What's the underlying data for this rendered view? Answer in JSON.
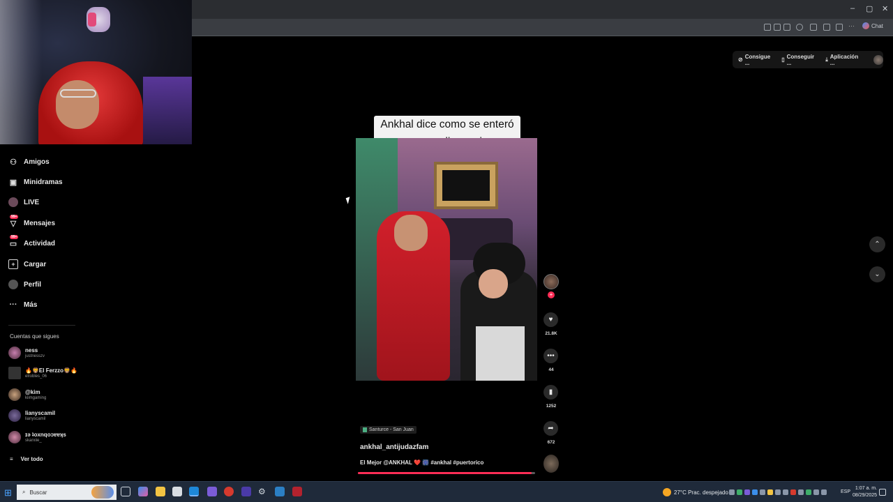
{
  "browser": {
    "window_controls": [
      "–",
      "▢",
      "✕"
    ],
    "chat_label": "Chat"
  },
  "sidebar": {
    "items": [
      {
        "label": "Amigos",
        "icon": "friends-icon"
      },
      {
        "label": "Minidramas",
        "icon": "minidramas-icon"
      },
      {
        "label": "LIVE",
        "icon": "live-icon"
      },
      {
        "label": "Mensajes",
        "icon": "messages-icon",
        "badge": "99+"
      },
      {
        "label": "Actividad",
        "icon": "activity-icon",
        "badge": "99+"
      },
      {
        "label": "Cargar",
        "icon": "upload-icon"
      },
      {
        "label": "Perfil",
        "icon": "profile-icon"
      },
      {
        "label": "Más",
        "icon": "more-icon"
      }
    ],
    "following_title": "Cuentas que sigues",
    "following": [
      {
        "name": "ness",
        "user": "justnesszv"
      },
      {
        "name": "🔥🦁El Ferzzo🦁🔥",
        "user": "elrobles_06"
      },
      {
        "name": "@kim",
        "user": "kiimgaming"
      },
      {
        "name": "lianyscamil",
        "user": "lianyscamil"
      },
      {
        "name": "ɪǝ ʇoxnqoɔɐɐʞs",
        "user": "skarxiie_"
      }
    ],
    "see_all": "Ver todo"
  },
  "video": {
    "caption_line1": "Ankhal dice como se enteró",
    "caption_line2": "que no podia caminar:",
    "location": "Santurce - San Juan",
    "author": "ankhal_antijudazfam",
    "description": "El Mejor @ANKHAL ❤️ 🎆 #ankhal #puertorico",
    "progress": 0.98
  },
  "actions": {
    "likes": "21.8K",
    "comments": "44",
    "saves": "1252",
    "shares": "672"
  },
  "top_right": {
    "pill1": "Consigue ...",
    "pill2": "Conseguir ...",
    "pill3": "Aplicación ..."
  },
  "taskbar": {
    "search_placeholder": "Buscar",
    "weather": "27°C  Prac. despejado",
    "language": "ESP",
    "time": "1:07 a. m.",
    "date": "08/29/2025"
  }
}
